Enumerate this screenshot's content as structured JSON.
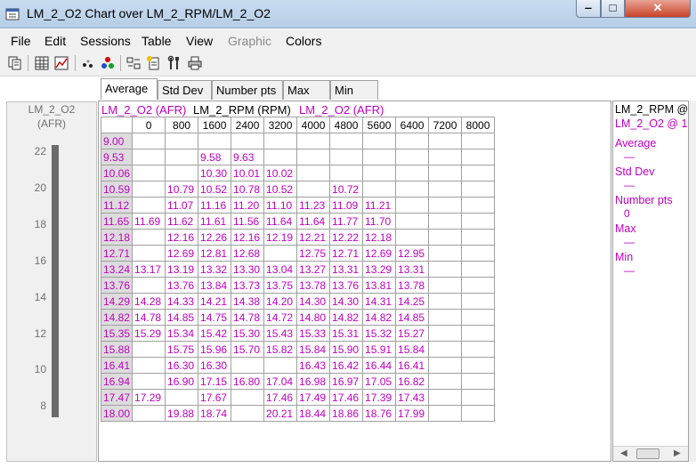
{
  "window": {
    "title": "LM_2_O2 Chart over LM_2_RPM/LM_2_O2"
  },
  "menu": [
    "File",
    "Edit",
    "Sessions",
    "Table",
    "View",
    "Graphic",
    "Colors"
  ],
  "tabs": [
    "Average",
    "Std Dev",
    "Number pts",
    "Max",
    "Min"
  ],
  "scale": {
    "title": "LM_2_O2",
    "unit": "(AFR)",
    "ticks": [
      "22",
      "20",
      "18",
      "16",
      "14",
      "12",
      "10",
      "8"
    ]
  },
  "table": {
    "z_label": "LM_2_O2 (AFR)",
    "x_label": "LM_2_RPM (RPM)",
    "y_label": "LM_2_O2 (AFR)",
    "columns": [
      "0",
      "800",
      "1600",
      "2400",
      "3200",
      "4000",
      "4800",
      "5600",
      "6400",
      "7200",
      "8000"
    ],
    "rows": [
      {
        "y": "9.00",
        "cells": [
          "",
          "",
          "",
          "",
          "",
          "",
          "",
          "",
          "",
          "",
          ""
        ]
      },
      {
        "y": "9.53",
        "cells": [
          "",
          "",
          "9.58",
          "9.63",
          "",
          "",
          "",
          "",
          "",
          "",
          ""
        ]
      },
      {
        "y": "10.06",
        "cells": [
          "",
          "",
          "10.30",
          "10.01",
          "10.02",
          "",
          "",
          "",
          "",
          "",
          ""
        ]
      },
      {
        "y": "10.59",
        "cells": [
          "",
          "10.79",
          "10.52",
          "10.78",
          "10.52",
          "",
          "10.72",
          "",
          "",
          "",
          ""
        ]
      },
      {
        "y": "11.12",
        "cells": [
          "",
          "11.07",
          "11.16",
          "11.20",
          "11.10",
          "11.23",
          "11.09",
          "11.21",
          "",
          "",
          ""
        ]
      },
      {
        "y": "11.65",
        "cells": [
          "11.69",
          "11.62",
          "11.61",
          "11.56",
          "11.64",
          "11.64",
          "11.77",
          "11.70",
          "",
          "",
          ""
        ]
      },
      {
        "y": "12.18",
        "cells": [
          "",
          "12.16",
          "12.26",
          "12.16",
          "12.19",
          "12.21",
          "12.22",
          "12.18",
          "",
          "",
          ""
        ]
      },
      {
        "y": "12.71",
        "cells": [
          "",
          "12.69",
          "12.81",
          "12.68",
          "",
          "12.75",
          "12.71",
          "12.69",
          "12.95",
          "",
          ""
        ]
      },
      {
        "y": "13.24",
        "cells": [
          "13.17",
          "13.19",
          "13.32",
          "13.30",
          "13.04",
          "13.27",
          "13.31",
          "13.29",
          "13.31",
          "",
          ""
        ]
      },
      {
        "y": "13.76",
        "cells": [
          "",
          "13.76",
          "13.84",
          "13.73",
          "13.75",
          "13.78",
          "13.76",
          "13.81",
          "13.78",
          "",
          ""
        ]
      },
      {
        "y": "14.29",
        "cells": [
          "14.28",
          "14.33",
          "14.21",
          "14.38",
          "14.20",
          "14.30",
          "14.30",
          "14.31",
          "14.25",
          "",
          ""
        ]
      },
      {
        "y": "14.82",
        "cells": [
          "14.78",
          "14.85",
          "14.75",
          "14.78",
          "14.72",
          "14.80",
          "14.82",
          "14.82",
          "14.85",
          "",
          ""
        ]
      },
      {
        "y": "15.35",
        "cells": [
          "15.29",
          "15.34",
          "15.42",
          "15.30",
          "15.43",
          "15.33",
          "15.31",
          "15.32",
          "15.27",
          "",
          ""
        ]
      },
      {
        "y": "15.88",
        "cells": [
          "",
          "15.75",
          "15.96",
          "15.70",
          "15.82",
          "15.84",
          "15.90",
          "15.91",
          "15.84",
          "",
          ""
        ]
      },
      {
        "y": "16.41",
        "cells": [
          "",
          "16.30",
          "16.30",
          "",
          "",
          "16.43",
          "16.42",
          "16.44",
          "16.41",
          "",
          ""
        ]
      },
      {
        "y": "16.94",
        "cells": [
          "",
          "16.90",
          "17.15",
          "16.80",
          "17.04",
          "16.98",
          "16.97",
          "17.05",
          "16.82",
          "",
          ""
        ]
      },
      {
        "y": "17.47",
        "cells": [
          "17.29",
          "",
          "17.67",
          "",
          "17.46",
          "17.49",
          "17.46",
          "17.39",
          "17.43",
          "",
          ""
        ]
      },
      {
        "y": "18.00",
        "cells": [
          "",
          "19.88",
          "18.74",
          "",
          "20.21",
          "18.44",
          "18.86",
          "18.76",
          "17.99",
          "",
          ""
        ]
      }
    ]
  },
  "side_panel": {
    "x_at": "LM_2_RPM @",
    "z_at": "LM_2_O2 @ 1",
    "average_label": "Average",
    "average_value": "—",
    "stddev_label": "Std Dev",
    "stddev_value": "—",
    "numpts_label": "Number pts",
    "numpts_value": "0",
    "max_label": "Max",
    "max_value": "—",
    "min_label": "Min",
    "min_value": "—"
  },
  "colors": {
    "value_text": "#c000c0",
    "row_header_bg": "#dcdcdc",
    "scale_bar": "#6b6b6b"
  },
  "icons": [
    "copy-icon",
    "grid-icon",
    "chart-icon",
    "dots-icon",
    "color-dots-icon",
    "table-edit-icon",
    "new-doc-icon",
    "tools-icon",
    "print-icon"
  ]
}
